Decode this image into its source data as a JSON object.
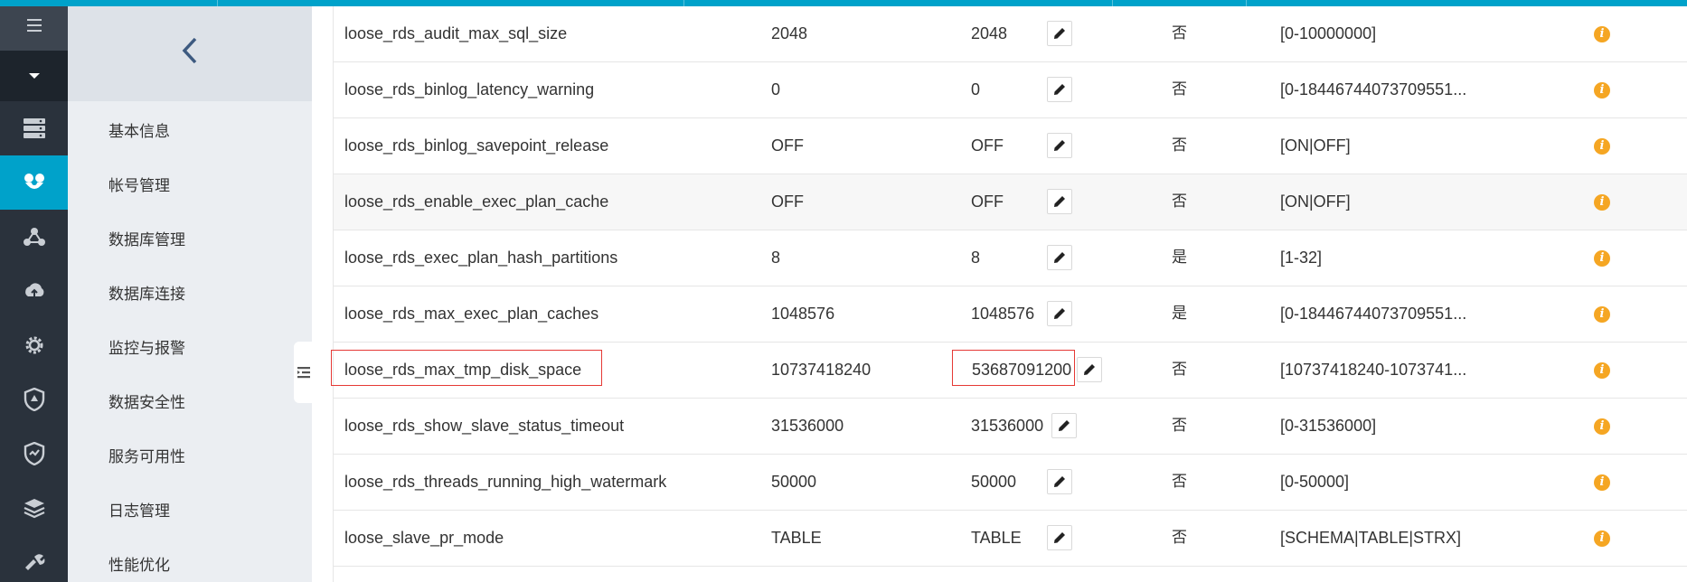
{
  "sidebar": {
    "items": [
      {
        "label": "基本信息"
      },
      {
        "label": "帐号管理"
      },
      {
        "label": "数据库管理"
      },
      {
        "label": "数据库连接"
      },
      {
        "label": "监控与报警"
      },
      {
        "label": "数据安全性"
      },
      {
        "label": "服务可用性"
      },
      {
        "label": "日志管理"
      },
      {
        "label": "性能优化"
      }
    ]
  },
  "rail": {
    "icons": [
      "menu-icon",
      "dropdown-caret-icon",
      "server-list-icon",
      "instance-icon",
      "cluster-icon",
      "cloud-sync-icon",
      "settings-gear-icon",
      "security-shield-icon",
      "availability-shield-icon",
      "database-stack-icon",
      "tools-icon"
    ],
    "active_index": 3
  },
  "params": {
    "rows": [
      {
        "name": "loose_rds_audit_max_sql_size",
        "default": "2048",
        "running": "2048",
        "restart": "否",
        "range": "[0-10000000]"
      },
      {
        "name": "loose_rds_binlog_latency_warning",
        "default": "0",
        "running": "0",
        "restart": "否",
        "range": "[0-18446744073709551..."
      },
      {
        "name": "loose_rds_binlog_savepoint_release",
        "default": "OFF",
        "running": "OFF",
        "restart": "否",
        "range": "[ON|OFF]"
      },
      {
        "name": "loose_rds_enable_exec_plan_cache",
        "default": "OFF",
        "running": "OFF",
        "restart": "否",
        "range": "[ON|OFF]"
      },
      {
        "name": "loose_rds_exec_plan_hash_partitions",
        "default": "8",
        "running": "8",
        "restart": "是",
        "range": "[1-32]"
      },
      {
        "name": "loose_rds_max_exec_plan_caches",
        "default": "1048576",
        "running": "1048576",
        "restart": "是",
        "range": "[0-18446744073709551..."
      },
      {
        "name": "loose_rds_max_tmp_disk_space",
        "default": "10737418240",
        "running": "53687091200",
        "restart": "否",
        "range": "[10737418240-1073741..."
      },
      {
        "name": "loose_rds_show_slave_status_timeout",
        "default": "31536000",
        "running": "31536000",
        "restart": "否",
        "range": "[0-31536000]"
      },
      {
        "name": "loose_rds_threads_running_high_watermark",
        "default": "50000",
        "running": "50000",
        "restart": "否",
        "range": "[0-50000]"
      },
      {
        "name": "loose_slave_pr_mode",
        "default": "TABLE",
        "running": "TABLE",
        "restart": "否",
        "range": "[SCHEMA|TABLE|STRX]"
      }
    ],
    "info_glyph": "i",
    "highlighted_row": 6
  },
  "colors": {
    "accent": "#00a2ca",
    "rail_bg": "#2a323c",
    "info": "#f5a623",
    "highlight": "#e53935"
  }
}
